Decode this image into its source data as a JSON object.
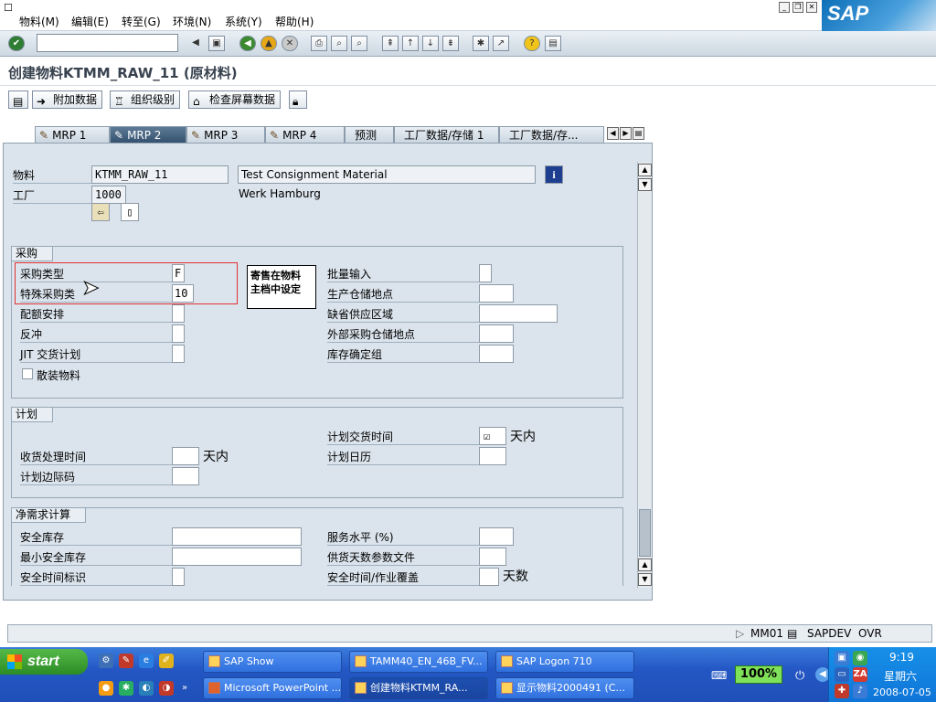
{
  "menu": [
    "物料(M)",
    "编辑(E)",
    "转至(G)",
    "环境(N)",
    "系统(Y)",
    "帮助(H)"
  ],
  "logo": "SAP",
  "title": "创建物料KTMM_RAW_11 (原材料)",
  "app_toolbar": {
    "additional_data": "附加数据",
    "org_levels": "组织级别",
    "check_screen_data": "检查屏幕数据"
  },
  "tabs": [
    "MRP 1",
    "MRP 2",
    "MRP 3",
    "MRP 4",
    "预测",
    "工厂数据/存储 1",
    "工厂数据/存..."
  ],
  "active_tab": "MRP 2",
  "header": {
    "material_label": "物料",
    "material_value": "KTMM_RAW_11",
    "material_desc": "Test Consignment Material",
    "plant_label": "工厂",
    "plant_value": "1000",
    "plant_desc": "Werk Hamburg"
  },
  "procurement": {
    "title": "采购",
    "proc_type_label": "采购类型",
    "proc_type_value": "F",
    "special_proc_label": "特殊采购类",
    "special_proc_value": "10",
    "quota_label": "配额安排",
    "backflush_label": "反冲",
    "jit_label": "JIT 交货计划",
    "bulk_label": "散装物料",
    "batch_entry_label": "批量输入",
    "prod_sloc_label": "生产仓储地点",
    "default_supply_area_label": "缺省供应区域",
    "ext_proc_sloc_label": "外部采购仓储地点",
    "stock_det_group_label": "库存确定组",
    "annotation_line1": "寄售在物料",
    "annotation_line2": "主档中设定"
  },
  "planning": {
    "title": "计划",
    "gr_time_label": "收货处理时间",
    "gr_time_unit": "天内",
    "planning_tf_label": "计划边际码",
    "planned_delivery_label": "计划交货时间",
    "planned_delivery_unit": "天内",
    "planning_calendar_label": "计划日历"
  },
  "net_req": {
    "title": "净需求计算",
    "safety_stock_label": "安全库存",
    "min_safety_stock_label": "最小安全库存",
    "safety_time_ind_label": "安全时间标识",
    "service_level_label": "服务水平 (%)",
    "coverage_profile_label": "供货天数参数文件",
    "safety_time_label": "安全时间/作业覆盖",
    "safety_time_unit": "天数"
  },
  "status": {
    "transaction": "MM01",
    "system": "SAPDEV",
    "mode": "OVR"
  },
  "taskbar": {
    "start": "start",
    "tasks_row1": [
      "SAP Show",
      "TAMM40_EN_46B_FV...",
      "SAP Logon 710"
    ],
    "tasks_row2": [
      "Microsoft PowerPoint ...",
      "创建物料KTMM_RA...",
      "显示物料2000491 (C..."
    ],
    "zoom": "100%",
    "time": "9:19",
    "weekday": "星期六",
    "date": "2008-07-05"
  }
}
